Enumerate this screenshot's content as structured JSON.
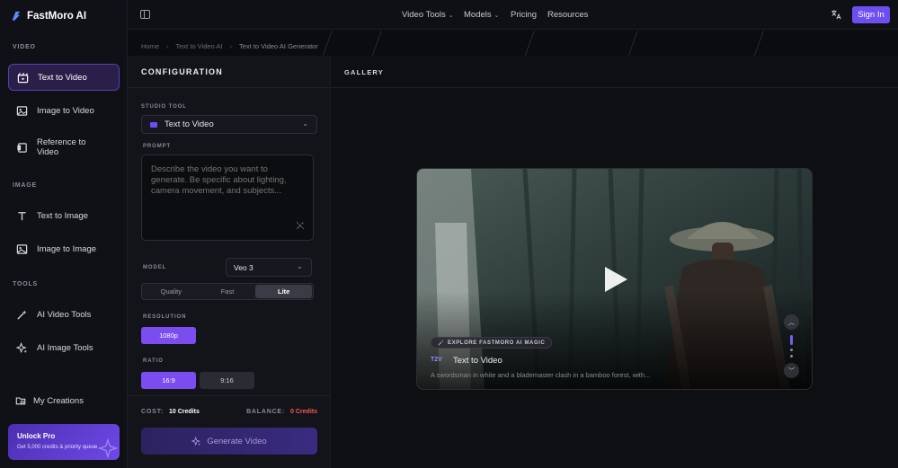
{
  "brand": {
    "name": "FastMoro AI"
  },
  "sidebar": {
    "sections": {
      "video": "VIDEO",
      "image": "IMAGE",
      "tools": "TOOLS"
    },
    "items": [
      {
        "label": "Text to Video",
        "icon": "clapperboard-icon",
        "active": true
      },
      {
        "label": "Image to Video",
        "icon": "image-icon"
      },
      {
        "label": "Reference to Video",
        "icon": "reference-icon"
      },
      {
        "label": "Text to Image",
        "icon": "text-icon"
      },
      {
        "label": "Image to Image",
        "icon": "image-edit-icon"
      },
      {
        "label": "AI Video Tools",
        "icon": "wand-icon"
      },
      {
        "label": "AI Image Tools",
        "icon": "sparkle-icon"
      }
    ],
    "creations": "My Creations",
    "pro": {
      "title": "Unlock Pro",
      "subtitle": "Get 5,000 credits & priority queue"
    }
  },
  "topbar": {
    "nav": [
      "Video Tools",
      "Models",
      "Pricing",
      "Resources"
    ],
    "signin": "Sign In"
  },
  "breadcrumb": [
    "Home",
    "Text to Video AI",
    "Text to Video AI Generator"
  ],
  "config": {
    "title": "CONFIGURATION",
    "studio_tool_label": "STUDIO TOOL",
    "studio_tool_value": "Text to Video",
    "prompt_label": "PROMPT",
    "prompt_placeholder": "Describe the video you want to generate. Be specific about lighting, camera movement, and subjects...",
    "model_label": "MODEL",
    "model_value": "Veo 3",
    "quality_options": [
      "Quality",
      "Fast",
      "Lite"
    ],
    "quality_selected": "Lite",
    "resolution_label": "RESOLUTION",
    "resolution_value": "1080p",
    "ratio_label": "RATIO",
    "ratio_options": [
      "16:9",
      "9:16"
    ],
    "ratio_selected": "16:9",
    "cost_label": "COST:",
    "cost_value": "10 Credits",
    "balance_label": "BALANCE:",
    "balance_value": "0 Credits",
    "generate": "Generate Video"
  },
  "gallery": {
    "title": "GALLERY",
    "tag": "EXPLORE FASTMORO AI MAGIC",
    "badge": "T2V",
    "video_title": "Text to Video",
    "video_desc": "A swordsman in white and a blademaster clash in a bamboo forest, with..."
  },
  "colors": {
    "accent": "#7b4cf0",
    "danger": "#f05a5a",
    "bg": "#0e0f13"
  }
}
